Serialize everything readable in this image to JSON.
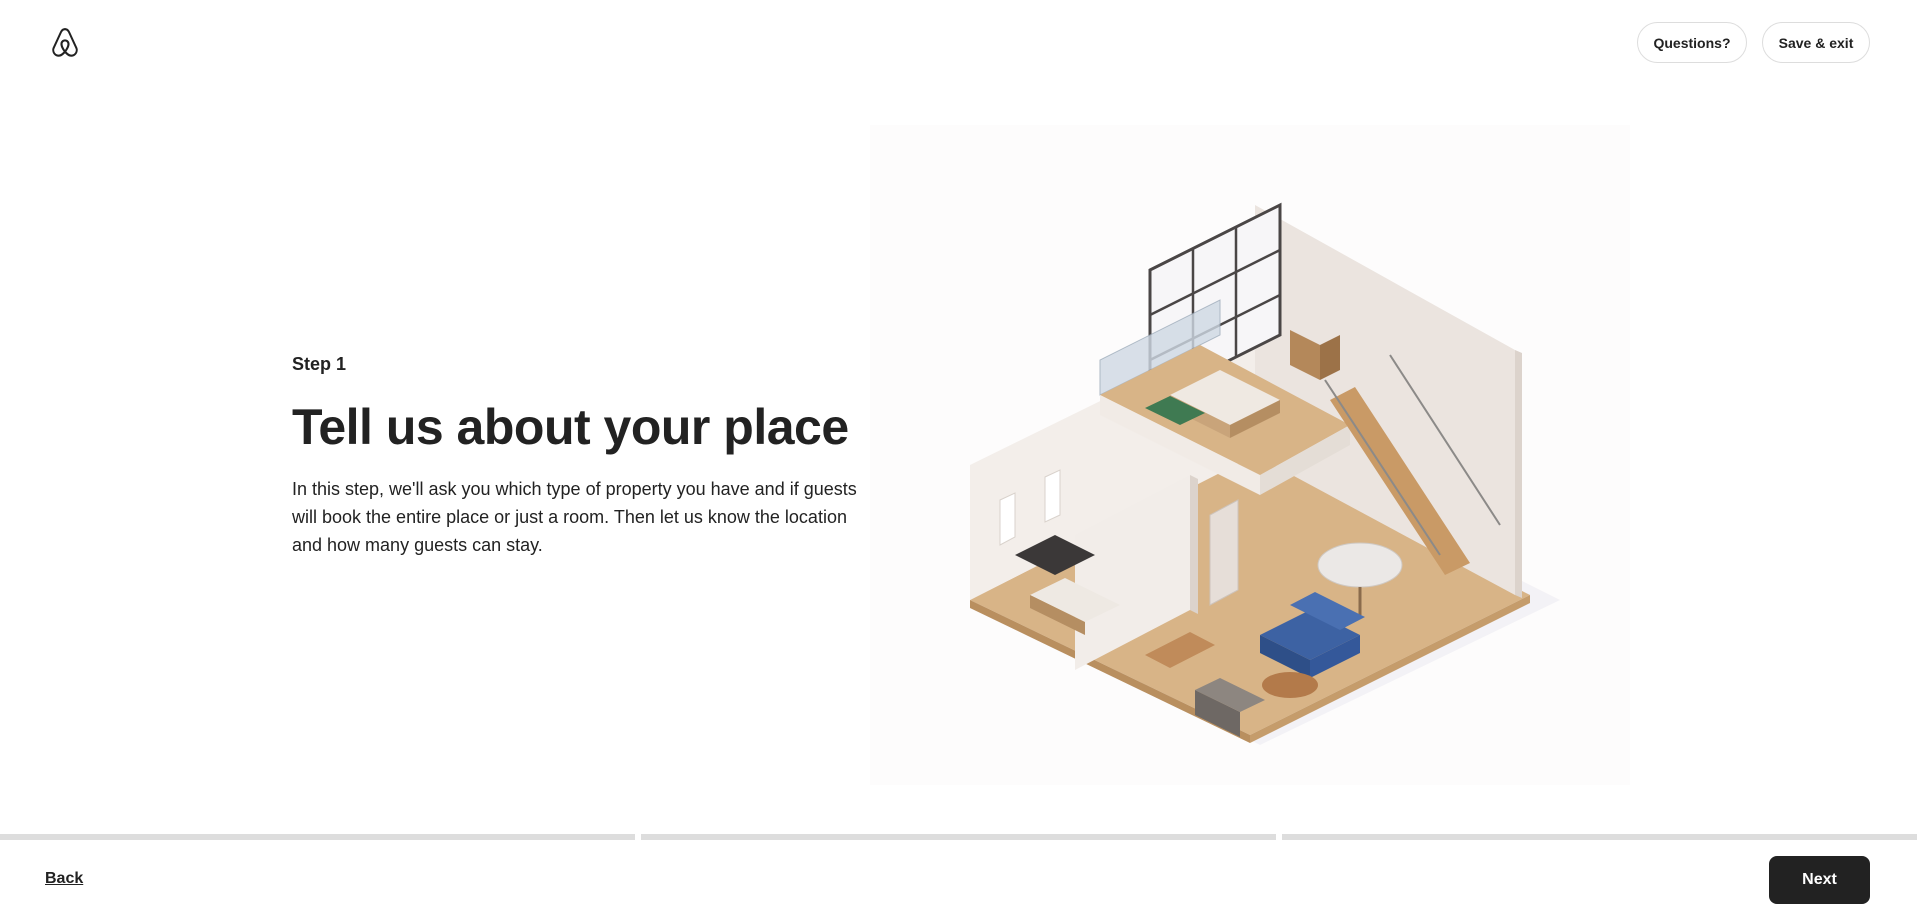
{
  "header": {
    "logo_icon": "airbnb-logo-icon",
    "questions_label": "Questions?",
    "save_exit_label": "Save & exit"
  },
  "main": {
    "step_label": "Step 1",
    "title": "Tell us about your place",
    "description": "In this step, we'll ask you which type of property you have and if guests will book the entire place or just a room. Then let us know the location and how many guests can stay.",
    "illustration_icon": "isometric-loft-illustration"
  },
  "progress": {
    "segments": 3,
    "completed_fraction": 0
  },
  "footer": {
    "back_label": "Back",
    "next_label": "Next"
  },
  "colors": {
    "text": "#222222",
    "border": "#dddddd",
    "primary_button": "#222222",
    "progress_track": "#dddddd"
  }
}
